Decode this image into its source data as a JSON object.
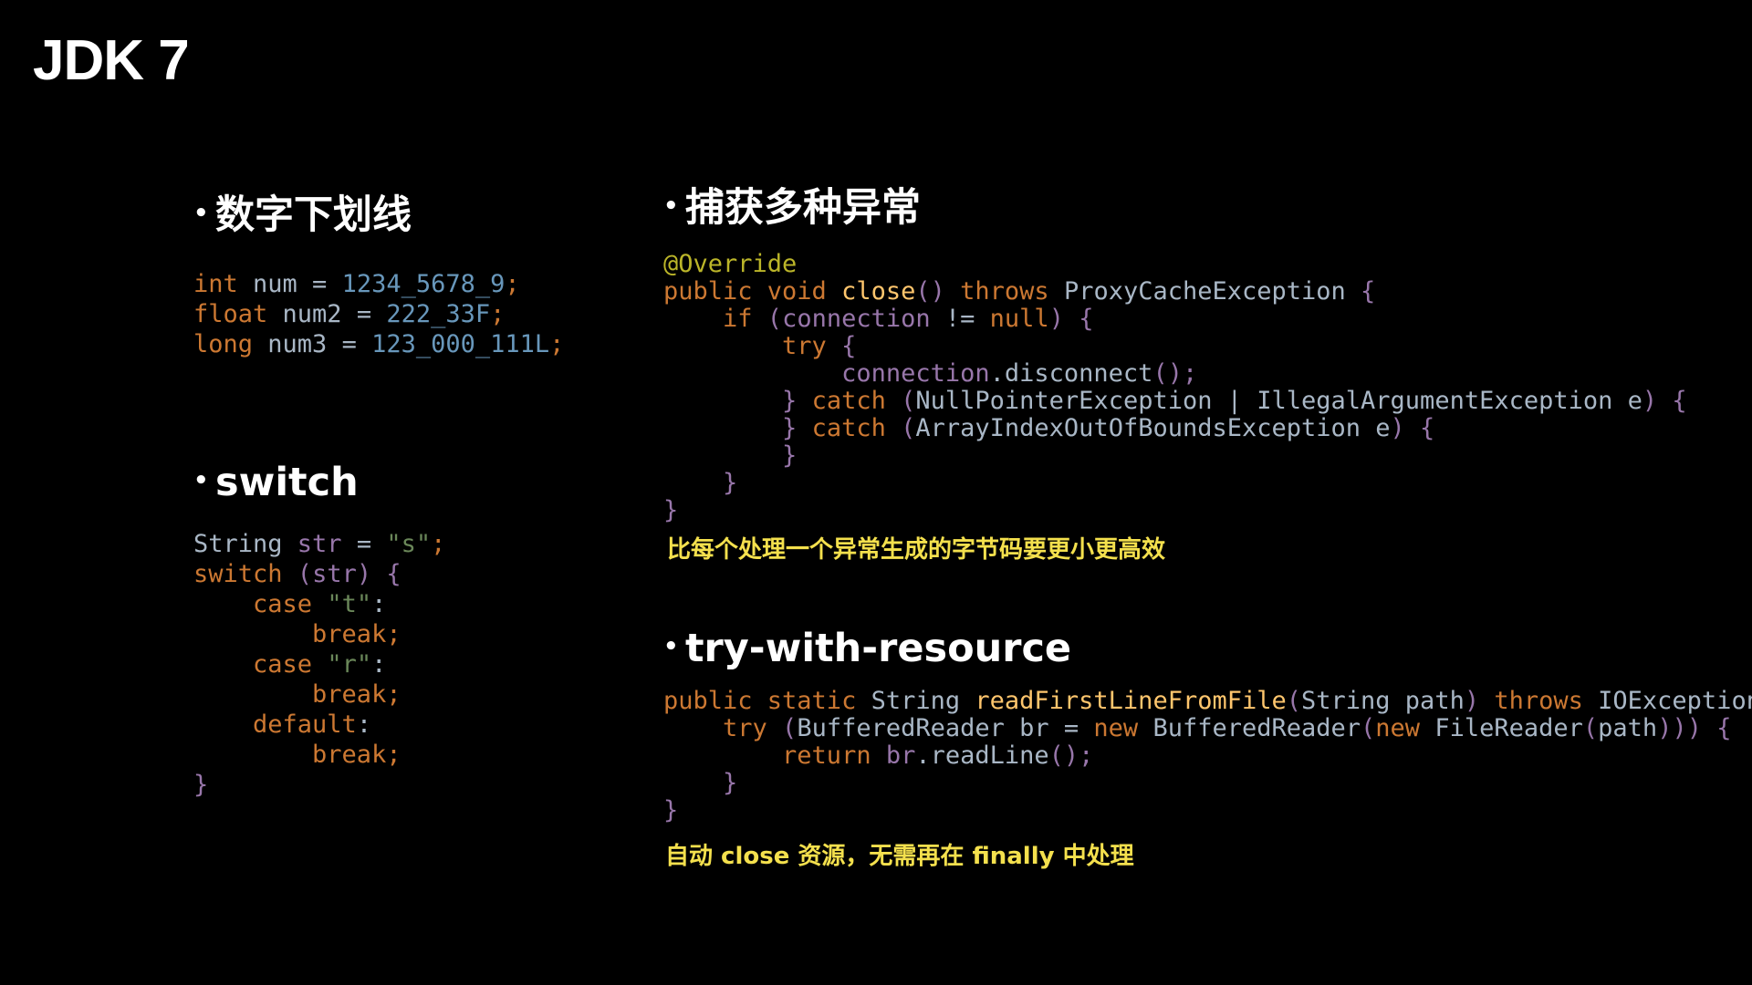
{
  "slide": {
    "title": "JDK 7"
  },
  "colors": {
    "background": "#000000",
    "text": "#ffffff",
    "keyword": "#cc7832",
    "identifier": "#a9b7c6",
    "number": "#6897bb",
    "variable": "#9876aa",
    "string": "#6a8759",
    "annotation": "#bbb529",
    "method": "#ffc66d",
    "note": "#f4e04d"
  },
  "sections": {
    "underscore": {
      "bullet": "•",
      "heading": "数字下划线",
      "code": [
        [
          {
            "t": "int",
            "c": "keyword"
          },
          {
            "t": " num = ",
            "c": "identifier"
          },
          {
            "t": "1234_5678_9",
            "c": "number"
          },
          {
            "t": ";",
            "c": "keyword"
          }
        ],
        [
          {
            "t": "float",
            "c": "keyword"
          },
          {
            "t": " num2 = ",
            "c": "identifier"
          },
          {
            "t": "222_33F",
            "c": "number"
          },
          {
            "t": ";",
            "c": "keyword"
          }
        ],
        [
          {
            "t": "long",
            "c": "keyword"
          },
          {
            "t": " num3 = ",
            "c": "identifier"
          },
          {
            "t": "123_000_111L",
            "c": "number"
          },
          {
            "t": ";",
            "c": "keyword"
          }
        ]
      ]
    },
    "switch": {
      "bullet": "•",
      "heading": "switch",
      "code": [
        [
          {
            "t": "String ",
            "c": "identifier"
          },
          {
            "t": "str",
            "c": "variable"
          },
          {
            "t": " = ",
            "c": "identifier"
          },
          {
            "t": "\"s\"",
            "c": "string"
          },
          {
            "t": ";",
            "c": "keyword"
          }
        ],
        [
          {
            "t": "switch",
            "c": "keyword"
          },
          {
            "t": " (",
            "c": "variable"
          },
          {
            "t": "str",
            "c": "variable"
          },
          {
            "t": ") {",
            "c": "variable"
          }
        ],
        [
          {
            "t": "    case ",
            "c": "keyword"
          },
          {
            "t": "\"t\"",
            "c": "string"
          },
          {
            "t": ":",
            "c": "identifier"
          }
        ],
        [
          {
            "t": "        break;",
            "c": "keyword"
          }
        ],
        [
          {
            "t": "    case ",
            "c": "keyword"
          },
          {
            "t": "\"r\"",
            "c": "string"
          },
          {
            "t": ":",
            "c": "identifier"
          }
        ],
        [
          {
            "t": "        break;",
            "c": "keyword"
          }
        ],
        [
          {
            "t": "    default",
            "c": "keyword"
          },
          {
            "t": ":",
            "c": "identifier"
          }
        ],
        [
          {
            "t": "        break;",
            "c": "keyword"
          }
        ],
        [
          {
            "t": "}",
            "c": "variable"
          }
        ]
      ]
    },
    "multi_catch": {
      "bullet": "•",
      "heading": "捕获多种异常",
      "code": [
        [
          {
            "t": "@Override",
            "c": "annotation"
          }
        ],
        [
          {
            "t": "public void ",
            "c": "keyword"
          },
          {
            "t": "close",
            "c": "method"
          },
          {
            "t": "() ",
            "c": "variable"
          },
          {
            "t": "throws ",
            "c": "keyword"
          },
          {
            "t": "ProxyCacheException ",
            "c": "identifier"
          },
          {
            "t": "{",
            "c": "variable"
          }
        ],
        [
          {
            "t": "    if ",
            "c": "keyword"
          },
          {
            "t": "(",
            "c": "variable"
          },
          {
            "t": "connection ",
            "c": "variable"
          },
          {
            "t": "!= ",
            "c": "identifier"
          },
          {
            "t": "null",
            "c": "keyword"
          },
          {
            "t": ") {",
            "c": "variable"
          }
        ],
        [
          {
            "t": "        try ",
            "c": "keyword"
          },
          {
            "t": "{",
            "c": "variable"
          }
        ],
        [
          {
            "t": "            connection",
            "c": "variable"
          },
          {
            "t": ".disconnect",
            "c": "identifier"
          },
          {
            "t": "();",
            "c": "variable"
          }
        ],
        [
          {
            "t": "        } ",
            "c": "variable"
          },
          {
            "t": "catch ",
            "c": "keyword"
          },
          {
            "t": "(",
            "c": "variable"
          },
          {
            "t": "NullPointerException | IllegalArgumentException e",
            "c": "identifier"
          },
          {
            "t": ") {",
            "c": "variable"
          }
        ],
        [
          {
            "t": "        } ",
            "c": "variable"
          },
          {
            "t": "catch ",
            "c": "keyword"
          },
          {
            "t": "(",
            "c": "variable"
          },
          {
            "t": "ArrayIndexOutOfBoundsException e",
            "c": "identifier"
          },
          {
            "t": ") {",
            "c": "variable"
          }
        ],
        [
          {
            "t": "        }",
            "c": "variable"
          }
        ],
        [
          {
            "t": "    }",
            "c": "variable"
          }
        ],
        [
          {
            "t": "}",
            "c": "variable"
          }
        ]
      ],
      "note": "比每个处理一个异常生成的字节码要更小更高效"
    },
    "try_with_resource": {
      "bullet": "•",
      "heading": "try-with-resource",
      "code": [
        [
          {
            "t": "public static ",
            "c": "keyword"
          },
          {
            "t": "String ",
            "c": "identifier"
          },
          {
            "t": "readFirstLineFromFile",
            "c": "method"
          },
          {
            "t": "(",
            "c": "variable"
          },
          {
            "t": "String path",
            "c": "identifier"
          },
          {
            "t": ") ",
            "c": "variable"
          },
          {
            "t": "throws ",
            "c": "keyword"
          },
          {
            "t": "IOException ",
            "c": "identifier"
          },
          {
            "t": "{",
            "c": "variable"
          }
        ],
        [
          {
            "t": "    try ",
            "c": "keyword"
          },
          {
            "t": "(",
            "c": "variable"
          },
          {
            "t": "BufferedReader br = ",
            "c": "identifier"
          },
          {
            "t": "new ",
            "c": "keyword"
          },
          {
            "t": "BufferedReader",
            "c": "identifier"
          },
          {
            "t": "(",
            "c": "variable"
          },
          {
            "t": "new ",
            "c": "keyword"
          },
          {
            "t": "FileReader",
            "c": "identifier"
          },
          {
            "t": "(",
            "c": "variable"
          },
          {
            "t": "path",
            "c": "identifier"
          },
          {
            "t": "))) {",
            "c": "variable"
          }
        ],
        [
          {
            "t": "        return ",
            "c": "keyword"
          },
          {
            "t": "br",
            "c": "variable"
          },
          {
            "t": ".readLine",
            "c": "identifier"
          },
          {
            "t": "();",
            "c": "variable"
          }
        ],
        [
          {
            "t": "    }",
            "c": "variable"
          }
        ],
        [
          {
            "t": "}",
            "c": "variable"
          }
        ]
      ],
      "note": "自动 close 资源，无需再在 finally 中处理"
    }
  }
}
